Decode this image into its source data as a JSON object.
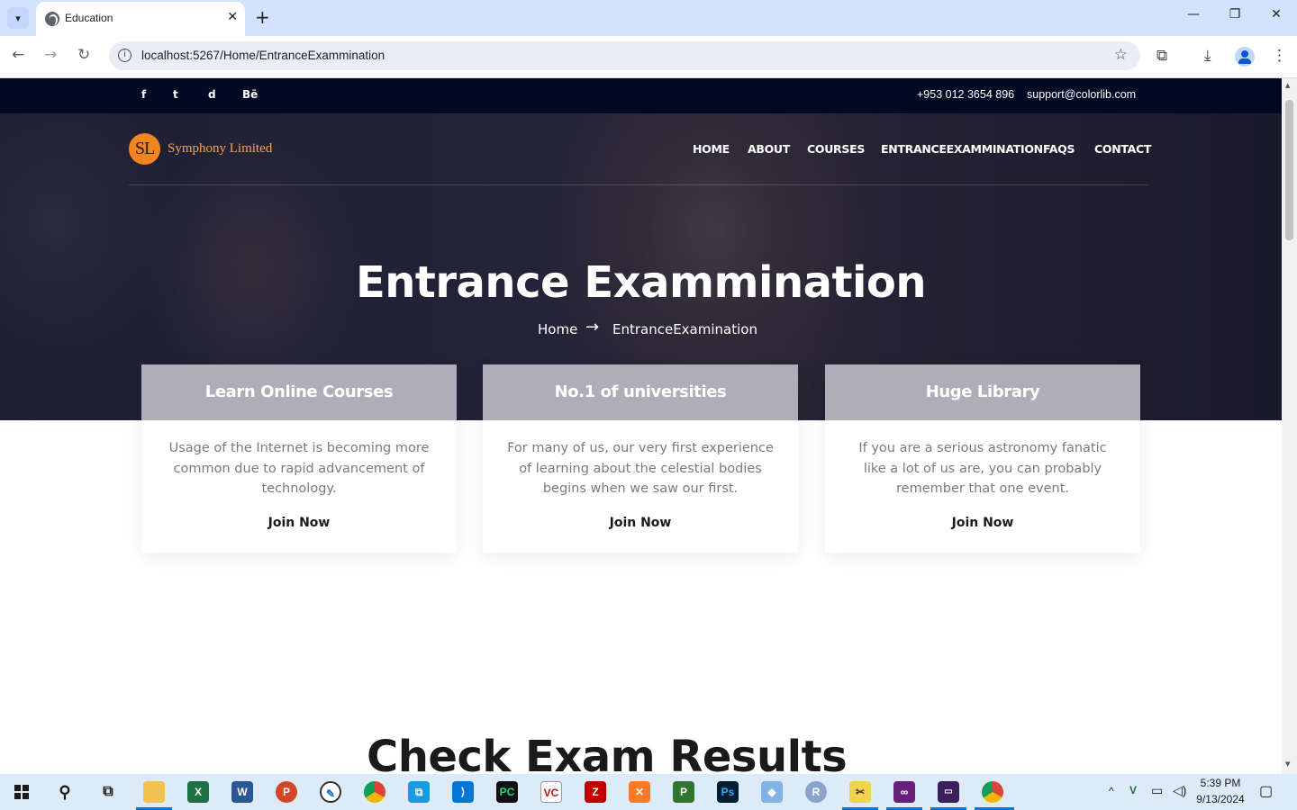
{
  "browser": {
    "tab_title": "Education",
    "url": "localhost:5267/Home/EntranceExammination"
  },
  "topbar": {
    "social": [
      "f",
      "t",
      "d",
      "Bē"
    ],
    "phone": "+953 012 3654 896",
    "email": "support@colorlib.com"
  },
  "brand": {
    "initials": "SL",
    "name": "Symphony Limited"
  },
  "nav": {
    "home": "HOME",
    "about": "ABOUT",
    "courses": "COURSES",
    "entrance": "ENTRANCEEXAMMINATION",
    "faqs": "FAQS",
    "contact": "CONTACT"
  },
  "hero": {
    "title": "Entrance Exammination",
    "breadcrumb_home": "Home",
    "breadcrumb_current": "EntranceExamination"
  },
  "features": [
    {
      "title": "Learn Online Courses",
      "body": "Usage of the Internet is becoming more common due to rapid advancement of technology.",
      "link": "Join Now"
    },
    {
      "title": "No.1 of universities",
      "body": "For many of us, our very first experience of learning about the celestial bodies begins when we saw our first.",
      "link": "Join Now"
    },
    {
      "title": "Huge Library",
      "body": "If you are a serious astronomy fanatic like a lot of us are, you can probably remember that one event.",
      "link": "Join Now"
    }
  ],
  "section": {
    "title": "Check Exam Results"
  },
  "taskbar": {
    "time": "5:39 PM",
    "date": "9/13/2024"
  },
  "colors": {
    "topbar_bg": "#020922",
    "brand_orange": "#f4841e",
    "taskbar_bg": "#ddeaf7"
  }
}
